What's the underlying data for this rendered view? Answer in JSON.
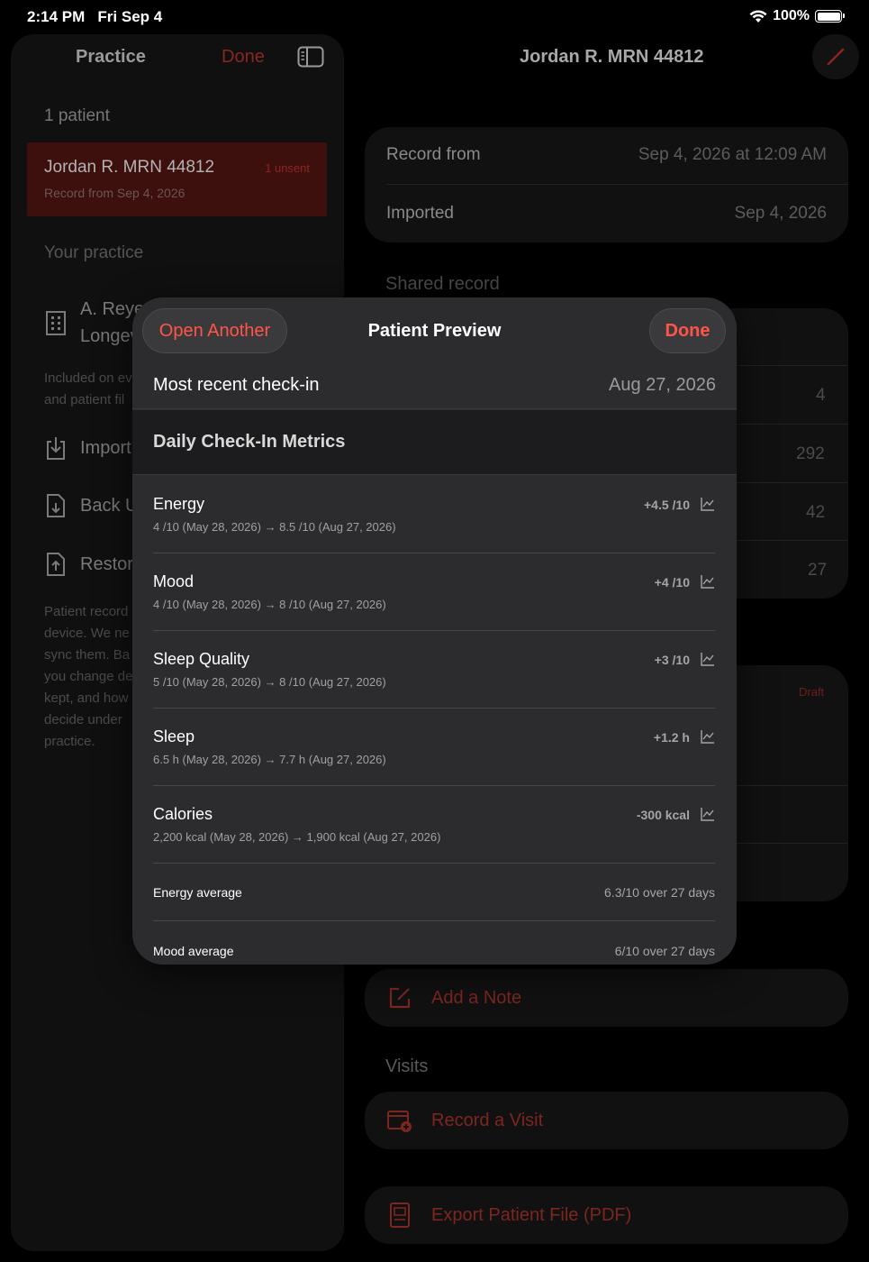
{
  "status_bar": {
    "time": "2:14 PM",
    "date": "Fri Sep 4",
    "battery": "100%"
  },
  "sidebar": {
    "title": "Practice",
    "done_label": "Done",
    "patient_count": "1 patient",
    "patient": {
      "name": "Jordan R.  MRN 44812",
      "badge": "1 unsent",
      "subtitle": "Record from Sep 4, 2026"
    },
    "your_practice_label": "Your practice",
    "practice_name_line1": "A. Reyes",
    "practice_name_line2": "Longev",
    "included_note_line1": "Included on ev",
    "included_note_line2": "and patient fil",
    "import_label": "Import",
    "backup_label": "Back U",
    "restore_label": "Restore",
    "footer_note": [
      "Patient record",
      "device. We ne",
      "sync them. Ba",
      "you change de",
      "kept, and how",
      "decide under",
      "practice."
    ]
  },
  "detail": {
    "title": "Jordan R.  MRN 44812",
    "record_from_label": "Record from",
    "record_from_value": "Sep 4, 2026 at 12:09 AM",
    "imported_label": "Imported",
    "imported_value": "Sep 4, 2026",
    "shared_record_label": "Shared record",
    "numbers": [
      "4",
      "292",
      "42",
      "27"
    ],
    "draft_label": "Draft",
    "add_note_label": "Add a Note",
    "visits_label": "Visits",
    "record_visit_label": "Record a Visit",
    "export_label": "Export Patient File (PDF)"
  },
  "modal": {
    "open_another_label": "Open Another",
    "title": "Patient Preview",
    "done_label": "Done",
    "most_recent_label": "Most recent check-in",
    "most_recent_value": "Aug 27, 2026",
    "metrics_header": "Daily Check-In Metrics",
    "metrics": [
      {
        "name": "Energy",
        "detail": "4 /10 (May 28, 2026)  →  8.5 /10 (Aug 27, 2026)",
        "delta": "+4.5 /10"
      },
      {
        "name": "Mood",
        "detail": "4 /10 (May 28, 2026)  →  8 /10 (Aug 27, 2026)",
        "delta": "+4 /10"
      },
      {
        "name": "Sleep Quality",
        "detail": "5 /10 (May 28, 2026)  →  8 /10 (Aug 27, 2026)",
        "delta": "+3 /10"
      },
      {
        "name": "Sleep",
        "detail": "6.5 h (May 28, 2026)  →  7.7 h (Aug 27, 2026)",
        "delta": "+1.2 h"
      },
      {
        "name": "Calories",
        "detail": "2,200 kcal (May 28, 2026)  →  1,900 kcal (Aug 27, 2026)",
        "delta": "-300 kcal"
      }
    ],
    "averages": [
      {
        "label": "Energy average",
        "value": "6.3/10 over 27 days"
      },
      {
        "label": "Mood average",
        "value": "6/10 over 27 days"
      }
    ]
  },
  "colors": {
    "accent": "#ff5549",
    "background": "#000000",
    "modal": "#2c2c2e"
  }
}
